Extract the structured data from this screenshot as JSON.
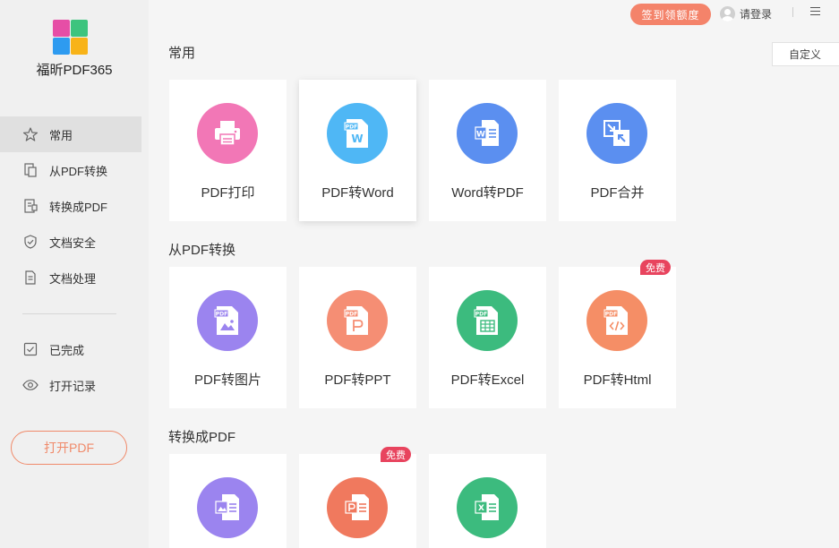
{
  "app": {
    "name": "福昕PDF365"
  },
  "sidebar": {
    "items": [
      {
        "label": "常用",
        "icon": "star-icon",
        "active": true
      },
      {
        "label": "从PDF转换",
        "icon": "convert-from-pdf-icon"
      },
      {
        "label": "转换成PDF",
        "icon": "convert-to-pdf-icon"
      },
      {
        "label": "文档安全",
        "icon": "shield-icon"
      },
      {
        "label": "文档处理",
        "icon": "document-icon"
      },
      {
        "label": "已完成",
        "icon": "checkbox-icon"
      },
      {
        "label": "打开记录",
        "icon": "eye-icon"
      }
    ],
    "open_button": "打开PDF"
  },
  "topbar": {
    "sign_button": "签到领额度",
    "login": "请登录",
    "custom_button": "自定义"
  },
  "sections": [
    {
      "title": "常用",
      "cards": [
        {
          "label": "PDF打印",
          "color": "#f277b6",
          "icon": "printer-icon"
        },
        {
          "label": "PDF转Word",
          "color": "#4fb7f5",
          "icon": "pdf-to-word-icon"
        },
        {
          "label": "Word转PDF",
          "color": "#5b8ff0",
          "icon": "word-to-pdf-icon"
        },
        {
          "label": "PDF合并",
          "color": "#5b8ff0",
          "icon": "merge-icon"
        }
      ]
    },
    {
      "title": "从PDF转换",
      "cards": [
        {
          "label": "PDF转图片",
          "color": "#9b84ef",
          "icon": "pdf-to-image-icon"
        },
        {
          "label": "PDF转PPT",
          "color": "#f58e74",
          "icon": "pdf-to-ppt-icon"
        },
        {
          "label": "PDF转Excel",
          "color": "#3cbb7e",
          "icon": "pdf-to-excel-icon"
        },
        {
          "label": "PDF转Html",
          "color": "#f58e66",
          "icon": "pdf-to-html-icon",
          "badge": "免费"
        }
      ]
    },
    {
      "title": "转换成PDF",
      "cards": [
        {
          "label": "",
          "color": "#9b84ef",
          "icon": "image-to-pdf-icon"
        },
        {
          "label": "",
          "color": "#f0795e",
          "icon": "ppt-to-pdf-icon",
          "badge": "免费"
        },
        {
          "label": "",
          "color": "#3cbb7e",
          "icon": "excel-to-pdf-icon"
        }
      ]
    }
  ]
}
